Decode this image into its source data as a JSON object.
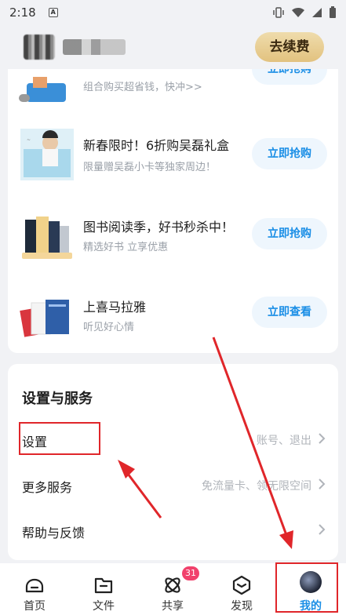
{
  "status_bar": {
    "time": "2:18",
    "a_badge": "A"
  },
  "header": {
    "renew_label": "去续费"
  },
  "promos": [
    {
      "title": "",
      "subtitle": "组合购买超省钱，快冲>>",
      "button": "立即抢购"
    },
    {
      "title": "新春限时！6折购吴磊礼盒",
      "subtitle": "限量赠吴磊小卡等独家周边！",
      "button": "立即抢购"
    },
    {
      "title": "图书阅读季，好书秒杀中！",
      "subtitle": "精选好书 立享优惠",
      "button": "立即抢购"
    },
    {
      "title": "上喜马拉雅",
      "subtitle": "听见好心情",
      "button": "立即查看"
    }
  ],
  "settings": {
    "section_title": "设置与服务",
    "items": [
      {
        "label": "设置",
        "hint": "账号、退出"
      },
      {
        "label": "更多服务",
        "hint": "免流量卡、领无限空间"
      },
      {
        "label": "帮助与反馈",
        "hint": ""
      }
    ]
  },
  "tabs": [
    {
      "label": "首页",
      "icon": "home-icon"
    },
    {
      "label": "文件",
      "icon": "folder-icon"
    },
    {
      "label": "共享",
      "icon": "share-icon",
      "badge": "31"
    },
    {
      "label": "发现",
      "icon": "discover-icon"
    },
    {
      "label": "我的",
      "icon": "avatar",
      "active": true
    }
  ],
  "colors": {
    "accent": "#1a8ee6",
    "highlight": "#e0262a",
    "renew_gold": "#e2c27f",
    "badge": "#f1416c"
  }
}
